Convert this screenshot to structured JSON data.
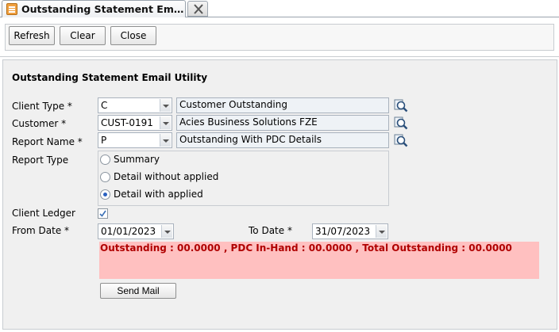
{
  "tab": {
    "title": "Outstanding Statement Em…"
  },
  "toolbar": {
    "refresh": "Refresh",
    "clear": "Clear",
    "close": "Close"
  },
  "form": {
    "title": "Outstanding Statement Email Utility",
    "client_type": {
      "label": "Client Type *",
      "value": "C",
      "desc": "Customer Outstanding"
    },
    "customer": {
      "label": "Customer *",
      "value": "CUST-0191",
      "desc": "Acies Business Solutions FZE"
    },
    "report_name": {
      "label": "Report Name *",
      "value": "P",
      "desc": "Outstanding With PDC Details"
    },
    "report_type": {
      "label": "Report Type",
      "options": [
        "Summary",
        "Detail without applied",
        "Detail with applied"
      ],
      "selected": "Detail with applied"
    },
    "client_ledger": {
      "label": "Client Ledger",
      "checked": true
    },
    "from_date": {
      "label": "From Date *",
      "value": "01/01/2023"
    },
    "to_date": {
      "label": "To Date *",
      "value": "31/07/2023"
    },
    "summary": "Outstanding : 00.0000 , PDC In-Hand : 00.0000 , Total Outstanding : 00.0000",
    "send_mail": "Send Mail"
  },
  "colors": {
    "summary_bg": "#ffc0c0",
    "summary_text": "#b00000",
    "radio_dot": "#2b61c0"
  },
  "icons": [
    "document-tab-icon",
    "close-icon",
    "lookup-search-icon",
    "dropdown-arrow-icon",
    "checkmark-icon"
  ]
}
